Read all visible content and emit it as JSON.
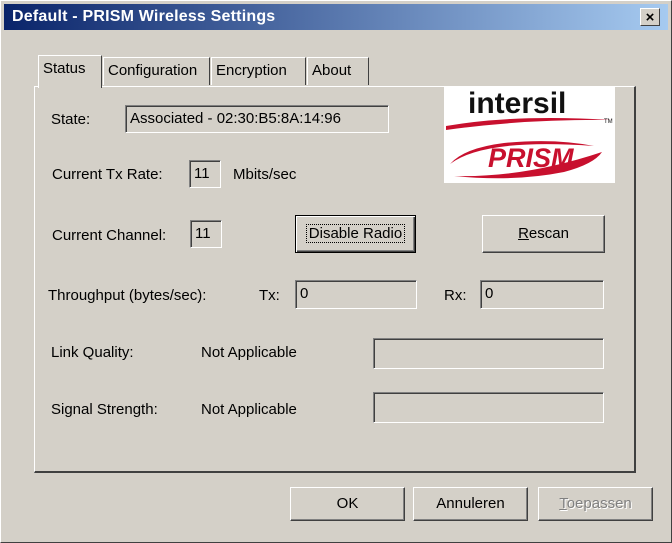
{
  "window": {
    "title": "Default - PRISM Wireless Settings",
    "close_label": "×"
  },
  "tabs": [
    {
      "label": "Status",
      "active": true
    },
    {
      "label": "Configuration",
      "active": false
    },
    {
      "label": "Encryption",
      "active": false
    },
    {
      "label": "About",
      "active": false
    }
  ],
  "logo": {
    "brand_top": "intersil",
    "brand_bottom": "PRISM",
    "tm": "TM"
  },
  "status": {
    "state_label": "State:",
    "state_value": "Associated - 02:30:B5:8A:14:96",
    "tx_rate_label": "Current Tx Rate:",
    "tx_rate_value": "11",
    "tx_rate_unit": "Mbits/sec",
    "channel_label": "Current Channel:",
    "channel_value": "11",
    "disable_radio_label": "Disable Radio",
    "rescan_label": "Rescan",
    "rescan_mnemonic": "R",
    "rescan_rest": "escan",
    "throughput_label": "Throughput (bytes/sec):",
    "tx_label": "Tx:",
    "tx_value": "0",
    "rx_label": "Rx:",
    "rx_value": "0",
    "link_quality_label": "Link Quality:",
    "link_quality_value": "Not Applicable",
    "signal_strength_label": "Signal Strength:",
    "signal_strength_value": "Not Applicable"
  },
  "footer": {
    "ok_label": "OK",
    "cancel_label": "Annuleren",
    "apply_mnemonic": "T",
    "apply_rest": "oepassen"
  },
  "colors": {
    "titlebar_start": "#0a246a",
    "titlebar_end": "#a6caf0",
    "logo_red": "#c8102e",
    "face": "#d4d0c8"
  }
}
